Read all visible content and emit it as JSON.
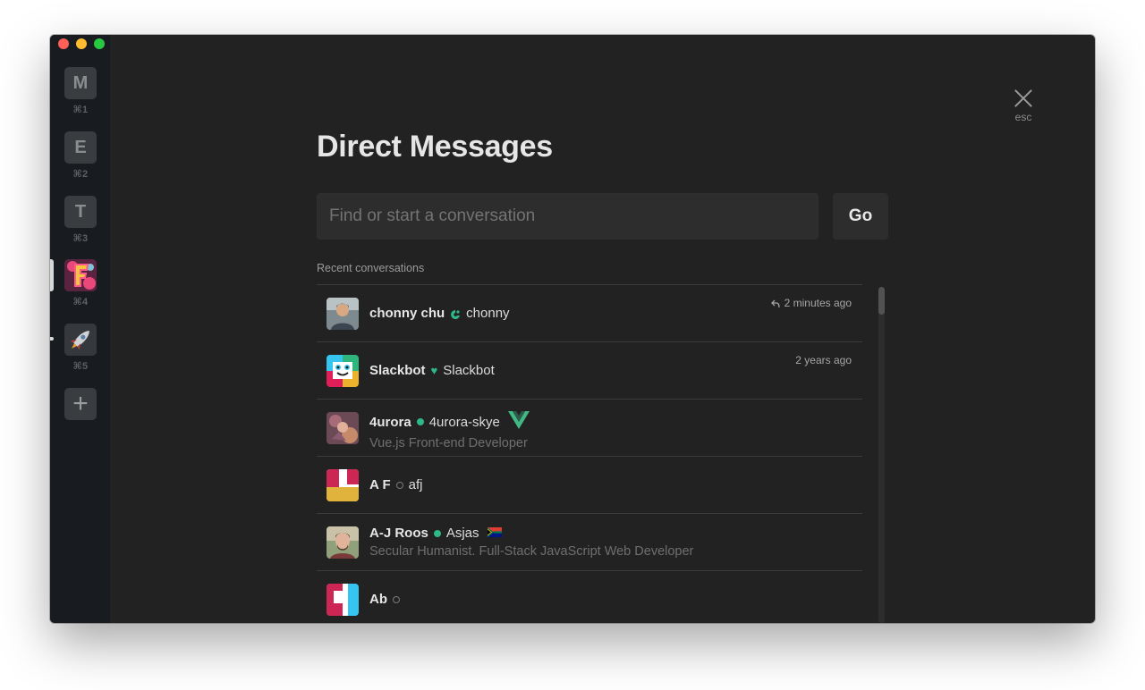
{
  "window": {
    "controls": [
      "close",
      "minimize",
      "zoom"
    ]
  },
  "teams": [
    {
      "letter": "M",
      "shortcut": "⌘1"
    },
    {
      "letter": "E",
      "shortcut": "⌘2"
    },
    {
      "letter": "T",
      "shortcut": "⌘3"
    },
    {
      "letter": "",
      "shortcut": "⌘4",
      "icon": "colorful-f-logo",
      "active": true
    },
    {
      "letter": "",
      "shortcut": "⌘5",
      "icon": "rocket-icon"
    }
  ],
  "add_team": {
    "label": "+"
  },
  "close": {
    "label": "esc"
  },
  "page": {
    "title": "Direct Messages",
    "search_placeholder": "Find or start a conversation",
    "go_label": "Go",
    "section_label": "Recent conversations"
  },
  "conversations": [
    {
      "name": "chonny chu",
      "status": "custom-emoji",
      "username": "chonny",
      "subtitle": "",
      "timestamp": "2 minutes ago",
      "has_reply_icon": true
    },
    {
      "name": "Slackbot",
      "status": "heart",
      "username": "Slackbot",
      "subtitle": "",
      "timestamp": "2 years ago"
    },
    {
      "name": "4urora",
      "status": "active",
      "username": "4urora-skye",
      "subtitle": "Vue.js Front-end Developer",
      "timestamp": "",
      "custom_status_icon": "vue-logo-icon"
    },
    {
      "name": "A F",
      "status": "away",
      "username": "afj",
      "subtitle": "",
      "timestamp": ""
    },
    {
      "name": "A-J Roos",
      "status": "active",
      "username": "Asjas",
      "subtitle": "Secular Humanist. Full-Stack JavaScript Web Developer",
      "timestamp": "",
      "custom_status_icon": "south-africa-flag-icon"
    },
    {
      "name": "Ab",
      "status": "away",
      "username": "",
      "subtitle": "",
      "timestamp": ""
    }
  ],
  "colors": {
    "background": "#222222",
    "sidebar": "#181b1f",
    "active_status": "#2eb886",
    "input_bg": "#2d2d2d",
    "vue_green": "#41b883"
  }
}
